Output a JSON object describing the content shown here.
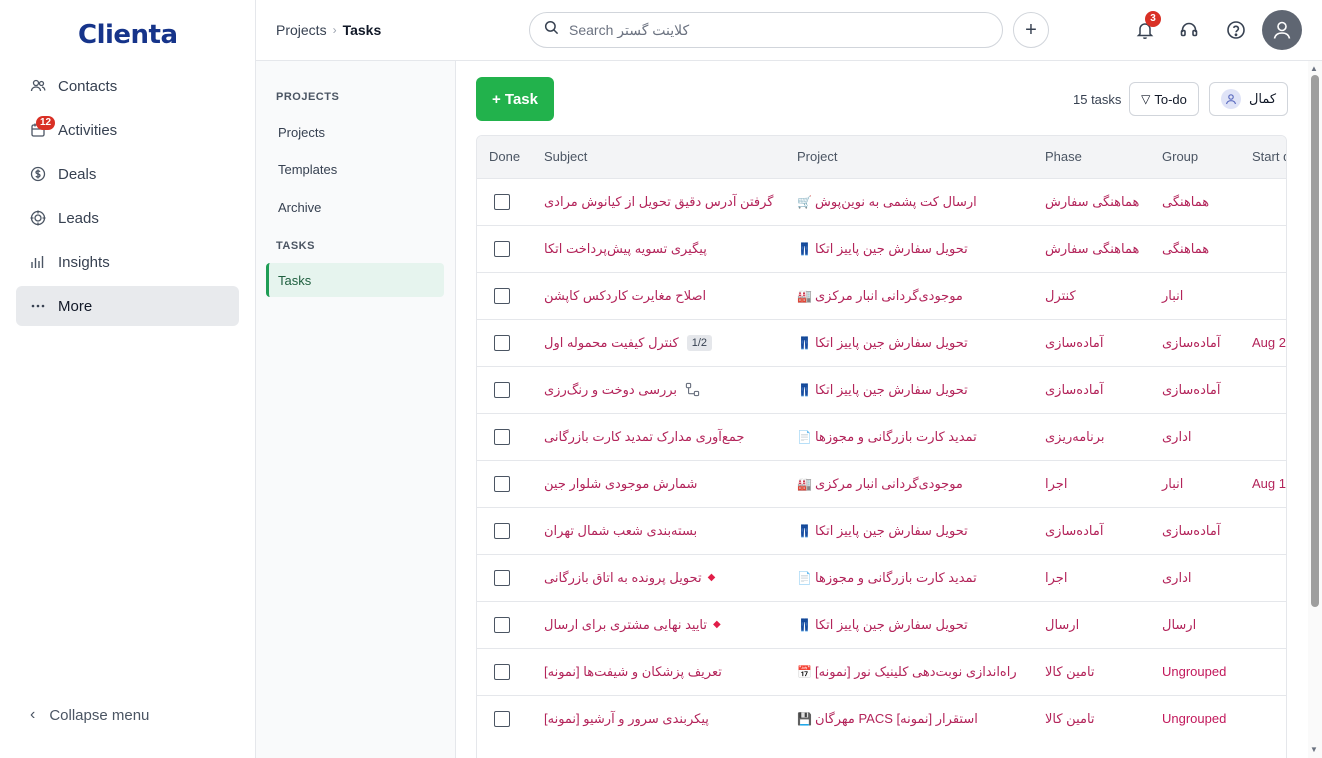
{
  "brand": {
    "logo": "Clienta"
  },
  "nav": {
    "items": [
      {
        "label": "Contacts",
        "icon": "contacts-icon"
      },
      {
        "label": "Activities",
        "icon": "calendar-icon",
        "badge": "12"
      },
      {
        "label": "Deals",
        "icon": "dollar-icon"
      },
      {
        "label": "Leads",
        "icon": "target-icon"
      },
      {
        "label": "Insights",
        "icon": "bar-chart-icon"
      },
      {
        "label": "More",
        "icon": "more-dots-icon"
      }
    ],
    "collapse_label": "Collapse menu"
  },
  "topbar": {
    "breadcrumb_root": "Projects",
    "breadcrumb_sep": "›",
    "breadcrumb_current": "Tasks",
    "search_placeholder": "Search کلاینت گستر",
    "plus": "+",
    "notification_count": "3"
  },
  "subnav": {
    "projects_heading": "PROJECTS",
    "projects_items": [
      "Projects",
      "Templates",
      "Archive"
    ],
    "tasks_heading": "TASKS",
    "tasks_items": [
      "Tasks"
    ]
  },
  "toolbar": {
    "add_task": "+ Task",
    "task_count": "15 tasks",
    "filter_label": "To-do",
    "filter_icon": "▽",
    "user_filter": "کمال"
  },
  "table": {
    "columns": [
      "Done",
      "Subject",
      "Project",
      "Phase",
      "Group",
      "Start d"
    ],
    "rows": [
      {
        "subject": "گرفتن آدرس دقیق تحویل از کیانوش مرادی",
        "project_icon": "🛒",
        "project": "ارسال کت پشمی به نوین‌پوش",
        "phase": "هماهنگی سفارش",
        "group": "هماهنگی",
        "start": ""
      },
      {
        "subject": "پیگیری تسویه پیش‌پرداخت اتکا",
        "project_icon": "👖",
        "project": "تحویل سفارش جین پاییز اتکا",
        "phase": "هماهنگی سفارش",
        "group": "هماهنگی",
        "start": ""
      },
      {
        "subject": "اصلاح مغایرت کاردکس کاپشن",
        "project_icon": "🏭",
        "project": "موجودی‌گردانی انبار مرکزی",
        "phase": "کنترل",
        "group": "انبار",
        "start": ""
      },
      {
        "subject": "کنترل کیفیت محموله اول",
        "chip": "1/2",
        "project_icon": "👖",
        "project": "تحویل سفارش جین پاییز اتکا",
        "phase": "آماده‌سازی",
        "group": "آماده‌سازی",
        "start": "Aug 2"
      },
      {
        "subject": "بررسی دوخت و رنگ‌رزی",
        "subtask_icon": "subtasks-icon",
        "project_icon": "👖",
        "project": "تحویل سفارش جین پاییز اتکا",
        "phase": "آماده‌سازی",
        "group": "آماده‌سازی",
        "start": ""
      },
      {
        "subject": "جمع‌آوری مدارک تمدید کارت بازرگانی",
        "project_icon": "📄",
        "project": "تمدید کارت بازرگانی و مجوزها",
        "phase": "برنامه‌ریزی",
        "group": "اداری",
        "start": ""
      },
      {
        "subject": "شمارش موجودی شلوار جین",
        "project_icon": "🏭",
        "project": "موجودی‌گردانی انبار مرکزی",
        "phase": "اجرا",
        "group": "انبار",
        "start": "Aug 1"
      },
      {
        "subject": "بسته‌بندی شعب شمال تهران",
        "project_icon": "👖",
        "project": "تحویل سفارش جین پاییز اتکا",
        "phase": "آماده‌سازی",
        "group": "آماده‌سازی",
        "start": ""
      },
      {
        "subject": "تحویل پرونده به اتاق بازرگانی",
        "diamond": "◆",
        "project_icon": "📄",
        "project": "تمدید کارت بازرگانی و مجوزها",
        "phase": "اجرا",
        "group": "اداری",
        "start": ""
      },
      {
        "subject": "تایید نهایی مشتری برای ارسال",
        "diamond": "◆",
        "project_icon": "👖",
        "project": "تحویل سفارش جین پاییز اتکا",
        "phase": "ارسال",
        "group": "ارسال",
        "start": ""
      },
      {
        "subject": "تعریف پزشکان و شیفت‌ها [نمونه]",
        "project_icon": "📅",
        "project": "راه‌اندازی نوبت‌دهی کلینیک نور [نمونه]",
        "phase": "تامین کالا",
        "group": "Ungrouped",
        "start": ""
      },
      {
        "subject": "پیکربندی سرور و آرشیو [نمونه]",
        "project_icon": "💾",
        "project": "مهرگان PACS استقرار [نمونه]",
        "phase": "تامین کالا",
        "group": "Ungrouped",
        "start": ""
      }
    ]
  }
}
